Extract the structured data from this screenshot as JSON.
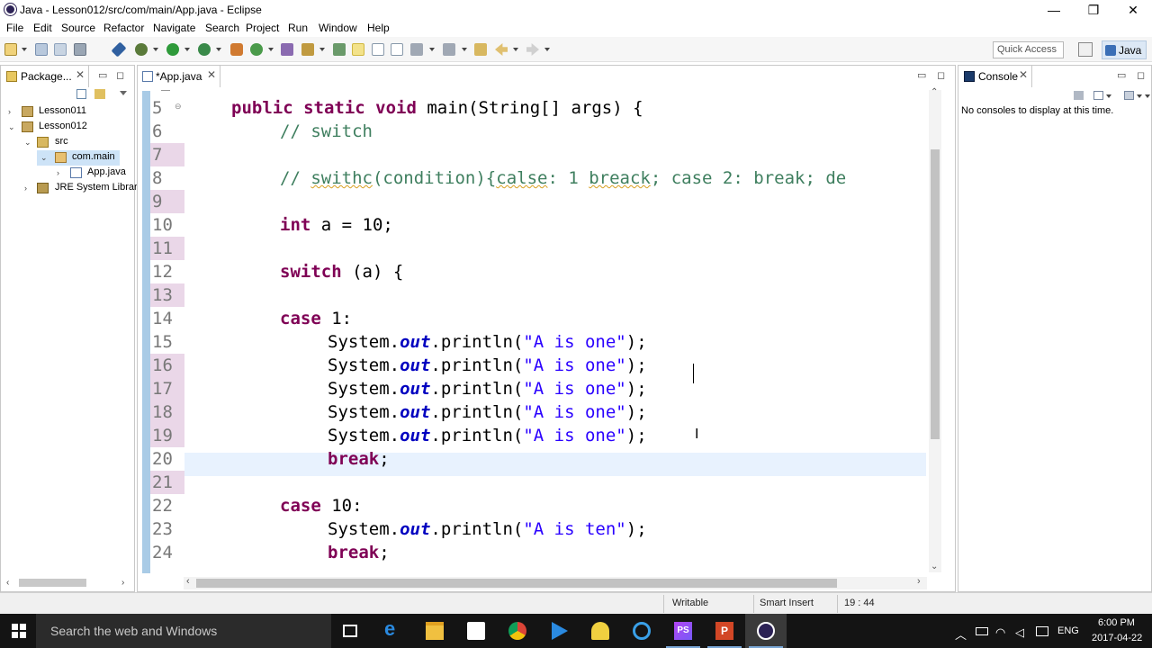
{
  "window": {
    "title": "Java - Lesson012/src/com/main/App.java - Eclipse",
    "minimize": "—",
    "maximize": "❐",
    "close": "✕"
  },
  "menu": [
    "File",
    "Edit",
    "Source",
    "Refactor",
    "Navigate",
    "Search",
    "Project",
    "Run",
    "Window",
    "Help"
  ],
  "toolbar": {
    "quick_access": "Quick Access",
    "perspective": "Java"
  },
  "package_explorer": {
    "tab": "Package...",
    "items": [
      {
        "label": "Lesson011",
        "arrow": "›",
        "level": 0,
        "icon": "project-icon"
      },
      {
        "label": "Lesson012",
        "arrow": "⌄",
        "level": 0,
        "icon": "project-icon"
      },
      {
        "label": "src",
        "arrow": "⌄",
        "level": 1,
        "icon": "source-folder-icon"
      },
      {
        "label": "com.main",
        "arrow": "⌄",
        "level": 2,
        "icon": "package-icon",
        "selected": true
      },
      {
        "label": "App.java",
        "arrow": "›",
        "level": 3,
        "icon": "java-file-icon"
      },
      {
        "label": "JRE System Librar",
        "arrow": "›",
        "level": 1,
        "icon": "library-icon"
      }
    ]
  },
  "editor": {
    "tab": "*App.java",
    "lines": [
      {
        "n": "5",
        "changed": false
      },
      {
        "n": "6",
        "changed": false
      },
      {
        "n": "7",
        "changed": true
      },
      {
        "n": "8",
        "changed": false
      },
      {
        "n": "9",
        "changed": true
      },
      {
        "n": "10",
        "changed": false
      },
      {
        "n": "11",
        "changed": true
      },
      {
        "n": "12",
        "changed": false
      },
      {
        "n": "13",
        "changed": true
      },
      {
        "n": "14",
        "changed": false
      },
      {
        "n": "15",
        "changed": false
      },
      {
        "n": "16",
        "changed": true
      },
      {
        "n": "17",
        "changed": true
      },
      {
        "n": "18",
        "changed": true
      },
      {
        "n": "19",
        "changed": true
      },
      {
        "n": "20",
        "changed": false
      },
      {
        "n": "21",
        "changed": true
      },
      {
        "n": "22",
        "changed": false
      },
      {
        "n": "23",
        "changed": false
      },
      {
        "n": "24",
        "changed": false
      }
    ],
    "code": {
      "l5_kw": "public static void",
      "l5_rest": " main(String[] args) {",
      "l6": "// switch",
      "l8_a": "// ",
      "l8_b": "swithc",
      "l8_c": "(condition){",
      "l8_d": "calse",
      "l8_e": ": 1 ",
      "l8_f": "breack",
      "l8_g": "; case 2: break; de",
      "l10_kw": "int",
      "l10_rest": " a = 10;",
      "l12_kw": "switch",
      "l12_rest": " (a) {",
      "l14_kw": "case",
      "l14_rest": " 1:",
      "sys": "System.",
      "out": "out",
      "println": ".println(",
      "str_one": "\"A is one\"",
      "end": ");",
      "l20_kw": "break",
      "semi": ";",
      "l22_kw": "case",
      "l22_rest": " 10:",
      "str_ten": "\"A is ten\""
    }
  },
  "console": {
    "tab": "Console",
    "message": "No consoles to display at this time."
  },
  "status": {
    "writable": "Writable",
    "insert_mode": "Smart Insert",
    "position": "19 : 44"
  },
  "taskbar": {
    "search": "Search the web and Windows",
    "language": "ENG",
    "time": "6:00 PM",
    "date": "2017-04-22"
  }
}
